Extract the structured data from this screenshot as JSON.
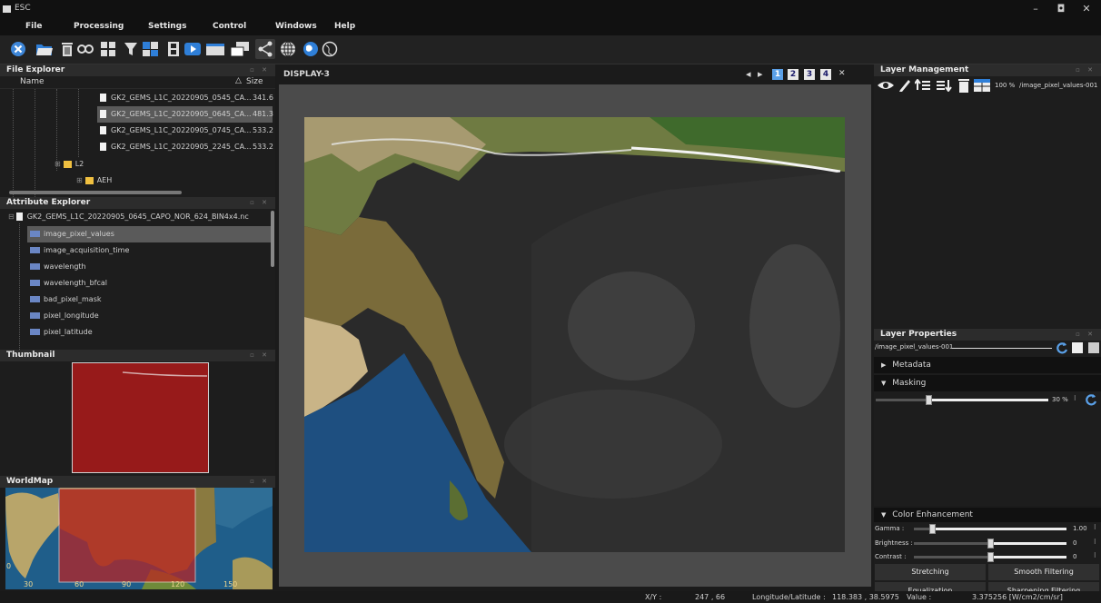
{
  "app": {
    "title": "ESC"
  },
  "window_controls": {
    "minimize": "–",
    "maximize": "◘",
    "close": "✕"
  },
  "menu": [
    "File",
    "Processing",
    "Settings",
    "Control",
    "Windows",
    "Help"
  ],
  "file_explorer": {
    "title": "File Explorer",
    "col_name": "Name",
    "col_size": "Size",
    "sort_glyph": "△",
    "files": [
      {
        "name": "GK2_GEMS_L1C_20220905_0545_CA...",
        "size": "341.6"
      },
      {
        "name": "GK2_GEMS_L1C_20220905_0645_CA...",
        "size": "481.3"
      },
      {
        "name": "GK2_GEMS_L1C_20220905_0745_CA...",
        "size": "533.2"
      },
      {
        "name": "GK2_GEMS_L1C_20220905_2245_CA...",
        "size": "533.2"
      }
    ],
    "folders": [
      {
        "name": "L2"
      },
      {
        "name": "AEH"
      }
    ]
  },
  "attribute_explorer": {
    "title": "Attribute Explorer",
    "root": "GK2_GEMS_L1C_20220905_0645_CAPO_NOR_624_BIN4x4.nc",
    "items": [
      "image_pixel_values",
      "image_acquisition_time",
      "wavelength",
      "wavelength_bfcal",
      "bad_pixel_mask",
      "pixel_longitude",
      "pixel_latitude"
    ]
  },
  "thumbnail": {
    "title": "Thumbnail"
  },
  "worldmap": {
    "title": "WorldMap",
    "ticks": [
      "30",
      "60",
      "90",
      "120",
      "150"
    ],
    "side_label": "0"
  },
  "display": {
    "title": "DISPLAY-3",
    "pages": [
      "1",
      "2",
      "3",
      "4"
    ],
    "prev": "◂",
    "next": "▸",
    "close": "✕"
  },
  "layer_management": {
    "title": "Layer Management",
    "opacity": "100 %",
    "layer_name": "/image_pixel_values-001"
  },
  "layer_properties": {
    "title": "Layer Properties",
    "layer_name": "/image_pixel_values-001",
    "metadata_label": "Metadata",
    "masking_label": "Masking",
    "masking_value": "30 %",
    "masking_fraction": 0.3
  },
  "color_enhancement": {
    "title": "Color Enhancement",
    "gamma_label": "Gamma :",
    "gamma_value": "1.00",
    "brightness_label": "Brightness :",
    "brightness_value": "0",
    "contrast_label": "Contrast :",
    "contrast_value": "0",
    "stretching": "Stretching",
    "smooth_filtering": "Smooth Filtering",
    "equalization": "Equalization",
    "sharpening_filtering": "Sharpening Filtering"
  },
  "status": {
    "xy_label": "X/Y :",
    "xy_value": "247 , 66",
    "lonlat_label": "Longitude/Latitude :",
    "lonlat_value": "118.383 , 38.5975",
    "value_label": "Value :",
    "value_value": "3.375256 [W/cm2/cm/sr]"
  },
  "colors": {
    "accent": "#2f7fd8",
    "selected_row": "#5a5a5a",
    "thumb_red": "#a01d1d",
    "panel_head": "#2c2c2c"
  }
}
